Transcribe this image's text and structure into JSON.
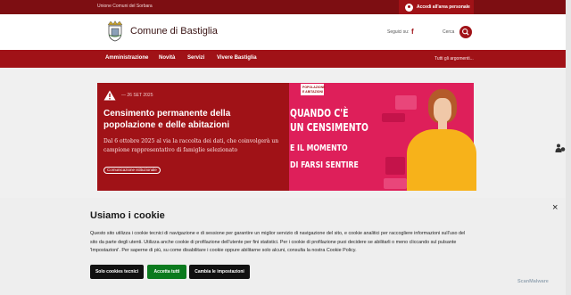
{
  "topbar": {
    "union": "Unione Comuni del Sorbara",
    "login": "Accedi all'area personale"
  },
  "header": {
    "title": "Comune di Bastiglia",
    "follow": "Seguici su:",
    "search": "Cerca"
  },
  "nav": {
    "items": [
      "Amministrazione",
      "Novità",
      "Servizi",
      "Vivere Bastiglia"
    ],
    "all_topics": "Tutti gli argomenti..."
  },
  "hero": {
    "date": "— 26 SET 2025",
    "title": "Censimento permanente della popolazione e delle abitazioni",
    "text": "Dal 6 ottobre 2025 al via la raccolta dei dati, che coinvolgerà un campione rappresentativo di famiglie selezionato",
    "tag": "Comunicazione istituzionale"
  },
  "promo": {
    "badge": [
      "POPOLAZIONE",
      "E ABITAZIONI"
    ],
    "lines": [
      "QUANDO C'È",
      "UN CENSIMENTO",
      "E IL MOMENTO",
      "DI FARSI SENTIRE"
    ]
  },
  "cookie": {
    "title": "Usiamo i cookie",
    "text": "Questo sito utilizza i cookie tecnici di navigazione e di sessione per garantire un miglior servizio di navigazione del sito, e cookie analitici per raccogliere informazioni sull'uso del sito da parte degli utenti. Utilizza anche cookie di profilazione dell'utente per fini statistici. Per i cookie di profilazione puoi decidere se abilitarli o meno cliccando sul pulsante 'Impostazioni'. Per saperne di più, su come disabilitare i cookie oppure abilitarne solo alcuni, consulta la nostra Cookie Policy.",
    "close": "×",
    "btn_technical": "Solo cookies tecnici",
    "btn_accept": "Accetta tutti",
    "btn_settings": "Cambia le impostazioni"
  },
  "watermark": "ScanMalware",
  "colors": {
    "brand": "#a01217",
    "brand_dark": "#7d0e12",
    "promo_pink": "#de1f5a",
    "accept_green": "#0b7a1e"
  }
}
